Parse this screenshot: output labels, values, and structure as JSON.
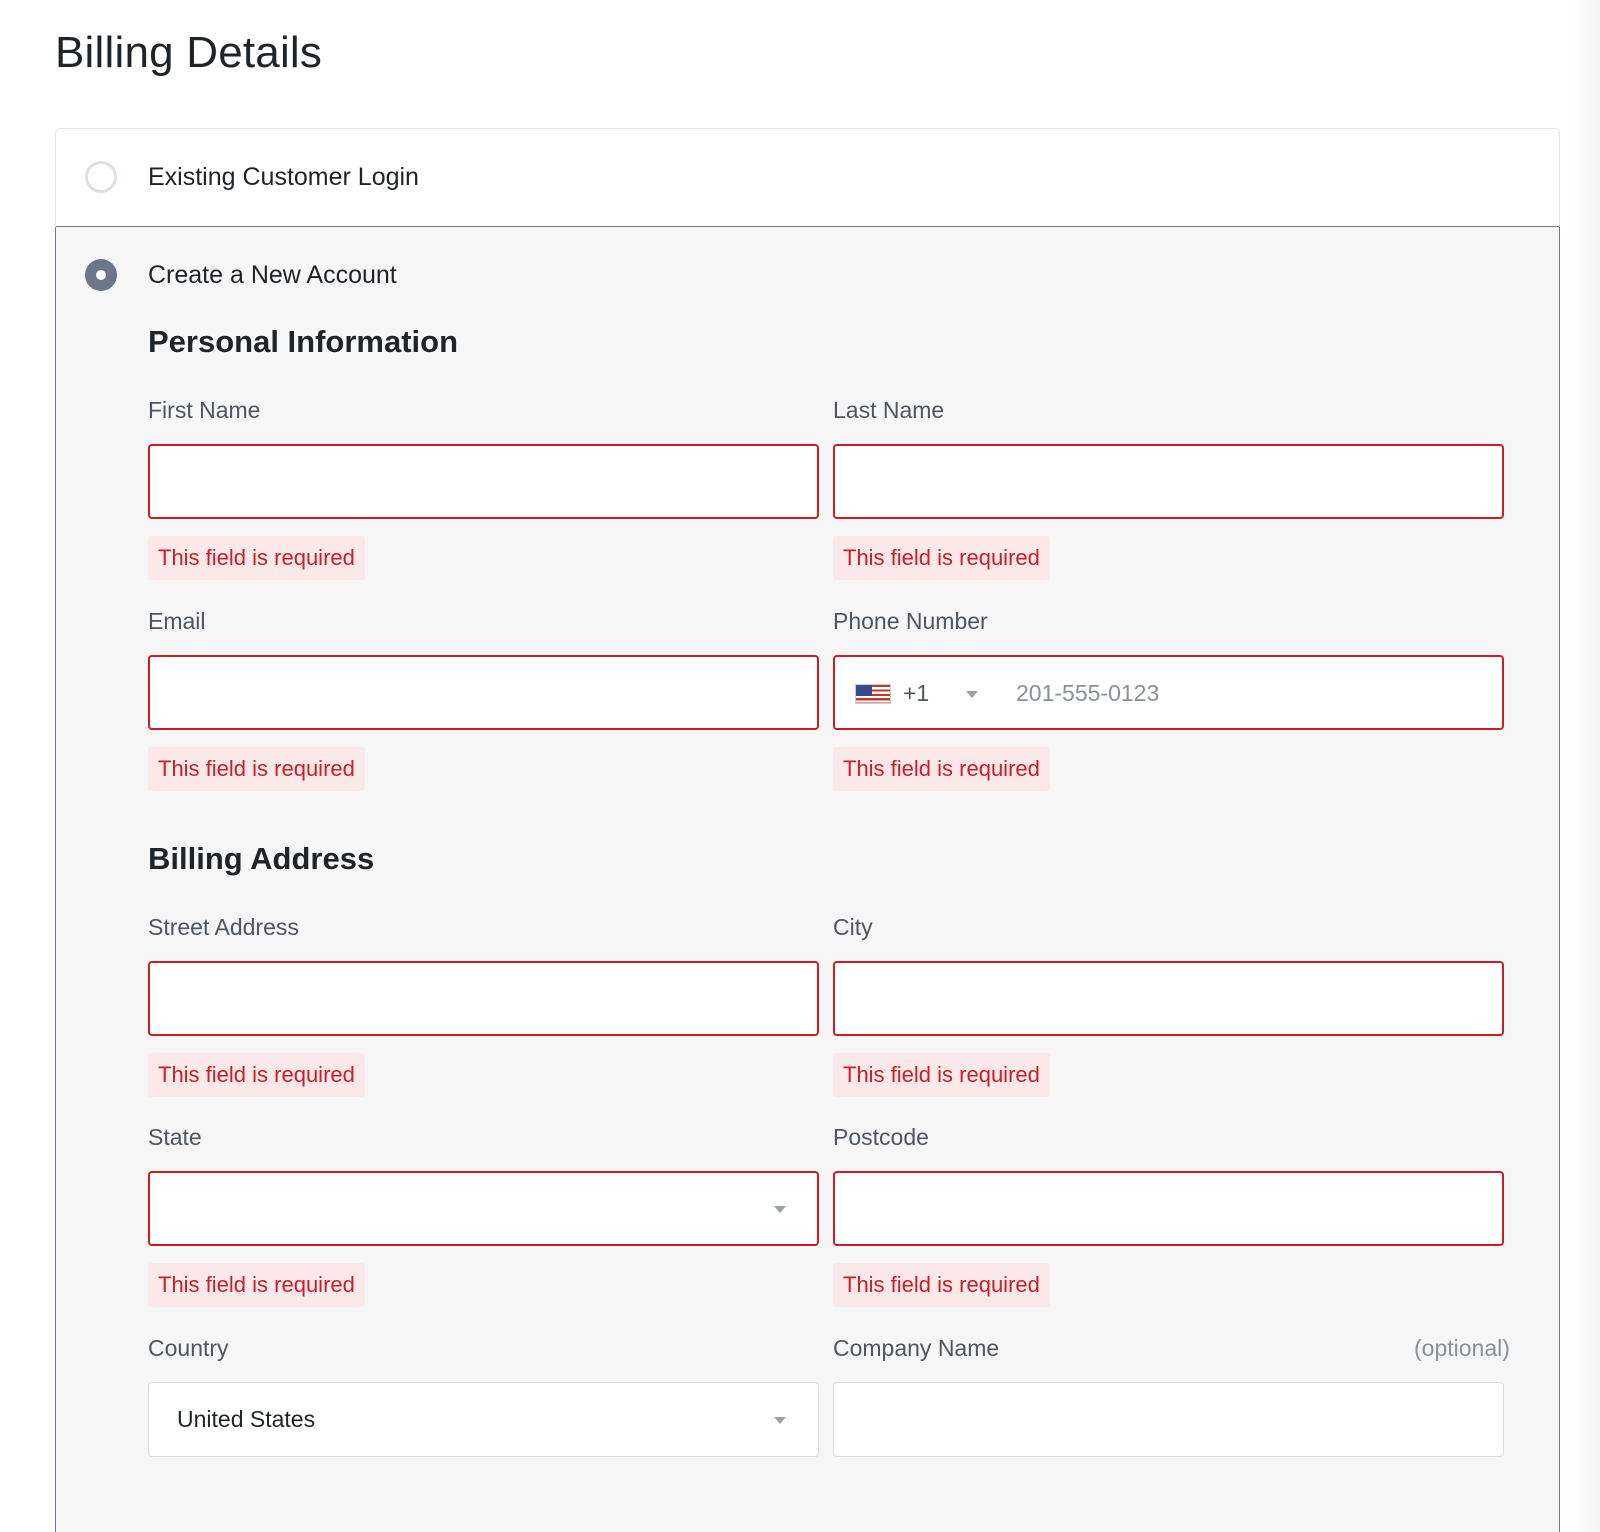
{
  "page": {
    "title": "Billing Details"
  },
  "options": {
    "login_label": "Existing Customer Login",
    "new_account_label": "Create a New Account"
  },
  "personal": {
    "heading": "Personal Information",
    "first_name_label": "First Name",
    "last_name_label": "Last Name",
    "email_label": "Email",
    "phone_label": "Phone Number",
    "phone_dial_code": "+1",
    "phone_placeholder": "201-555-0123",
    "phone_flag_icon": "us-flag-icon"
  },
  "billing": {
    "heading": "Billing Address",
    "street_label": "Street Address",
    "city_label": "City",
    "state_label": "State",
    "postcode_label": "Postcode",
    "country_label": "Country",
    "country_value": "United States",
    "company_label": "Company Name",
    "company_optional": "(optional)"
  },
  "errors": {
    "required": "This field is required"
  },
  "colors": {
    "error": "#cd1c24",
    "error_bg": "#fbe9e9",
    "radio_checked": "#6b7789",
    "panel_bg": "#f6f6f7"
  }
}
